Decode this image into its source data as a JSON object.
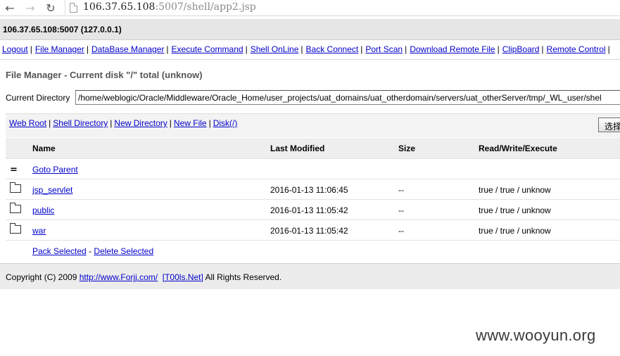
{
  "browser": {
    "url_host": "106.37.65.108",
    "url_rest": ":5007/shell/app2.jsp"
  },
  "host_info": "106.37.65.108:5007 (127.0.0.1)",
  "menu": [
    "Logout",
    "File Manager",
    "DataBase Manager",
    "Execute Command",
    "Shell OnLine",
    "Back Connect",
    "Port Scan",
    "Download Remote File",
    "ClipBoard",
    "Remote Control"
  ],
  "page_title": "File Manager - Current disk \"/\" total (unknow)",
  "current_directory": {
    "label": "Current Directory",
    "value": "/home/weblogic/Oracle/Middleware/Oracle_Home/user_projects/uat_domains/uat_otherdomain/servers/uat_otherServer/tmp/_WL_user/shel"
  },
  "toolbar": {
    "links": [
      "Web Root",
      "Shell Directory",
      "New Directory",
      "New File",
      "Disk(/)"
    ],
    "choose_button": "选择"
  },
  "table": {
    "headers": {
      "name": "Name",
      "modified": "Last Modified",
      "size": "Size",
      "rwx": "Read/Write/Execute"
    },
    "parent_label": "Goto Parent",
    "rows": [
      {
        "name": "jsp_servlet",
        "modified": "2016-01-13 11:06:45",
        "size": "--",
        "rwx": "true / true / unknow"
      },
      {
        "name": "public",
        "modified": "2016-01-13 11:05:42",
        "size": "--",
        "rwx": "true / true / unknow"
      },
      {
        "name": "war",
        "modified": "2016-01-13 11:05:42",
        "size": "--",
        "rwx": "true / true / unknow"
      }
    ],
    "pack_selected": "Pack Selected",
    "actions_sep": "-",
    "delete_selected": "Delete Selected"
  },
  "footer": {
    "copyright": "Copyright (C) 2009",
    "link1": "http://www.Forjj.com/",
    "link2": "[T00ls.Net]",
    "rights": "All Rights Reserved."
  },
  "watermark": "www.wooyun.org"
}
